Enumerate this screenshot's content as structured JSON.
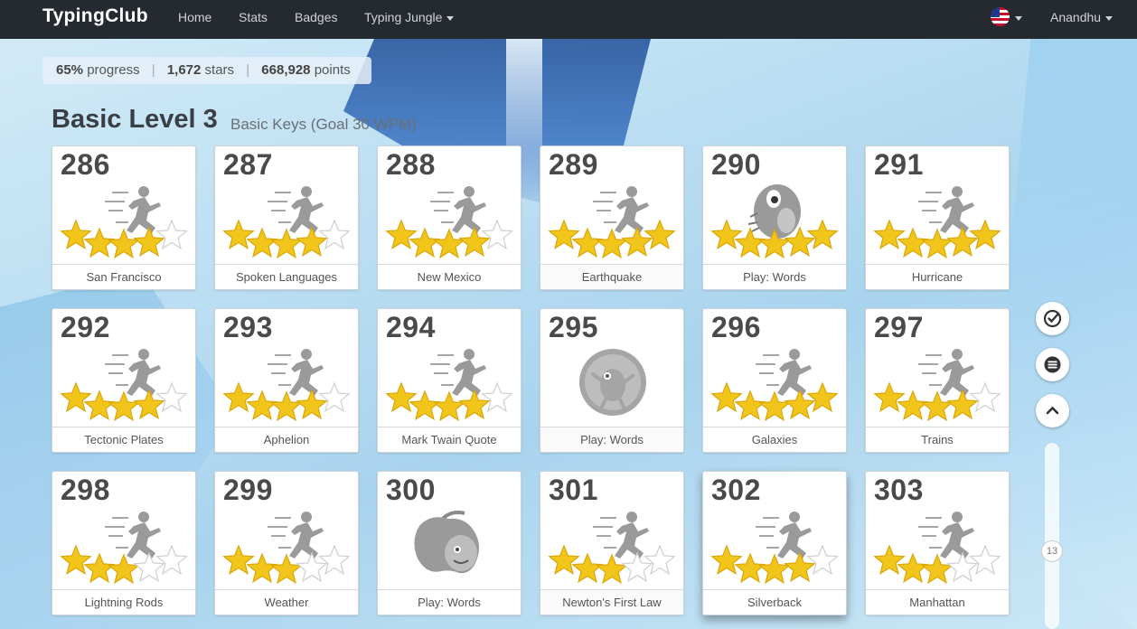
{
  "nav": {
    "brand": "TypingClub",
    "links": [
      "Home",
      "Stats",
      "Badges"
    ],
    "dropdown": "Typing Jungle",
    "user": "Anandhu"
  },
  "progress": {
    "percent": "65%",
    "percent_label": "progress",
    "stars": "1,672",
    "stars_label": "stars",
    "points": "668,928",
    "points_label": "points"
  },
  "level": {
    "title": "Basic Level 3",
    "subtitle": "Basic Keys (Goal 30 WPM)"
  },
  "lessons": [
    {
      "num": "286",
      "name": "San Francisco",
      "type": "typing",
      "stars": 4
    },
    {
      "num": "287",
      "name": "Spoken Languages",
      "type": "typing",
      "stars": 4
    },
    {
      "num": "288",
      "name": "New Mexico",
      "type": "typing",
      "stars": 4
    },
    {
      "num": "289",
      "name": "Earthquake",
      "type": "typing",
      "stars": 5
    },
    {
      "num": "290",
      "name": "Play: Words",
      "type": "game-creature",
      "stars": 5
    },
    {
      "num": "291",
      "name": "Hurricane",
      "type": "typing",
      "stars": 5
    },
    {
      "num": "292",
      "name": "Tectonic Plates",
      "type": "typing",
      "stars": 4
    },
    {
      "num": "293",
      "name": "Aphelion",
      "type": "typing",
      "stars": 4
    },
    {
      "num": "294",
      "name": "Mark Twain Quote",
      "type": "typing",
      "stars": 4
    },
    {
      "num": "295",
      "name": "Play: Words",
      "type": "game-locked",
      "stars": 0
    },
    {
      "num": "296",
      "name": "Galaxies",
      "type": "typing",
      "stars": 5
    },
    {
      "num": "297",
      "name": "Trains",
      "type": "typing",
      "stars": 4
    },
    {
      "num": "298",
      "name": "Lightning Rods",
      "type": "typing",
      "stars": 3
    },
    {
      "num": "299",
      "name": "Weather",
      "type": "typing",
      "stars": 3
    },
    {
      "num": "300",
      "name": "Play: Words",
      "type": "game-apple",
      "stars": 0
    },
    {
      "num": "301",
      "name": "Newton's First Law",
      "type": "typing",
      "stars": 3
    },
    {
      "num": "302",
      "name": "Silverback",
      "type": "typing",
      "stars": 4
    },
    {
      "num": "303",
      "name": "Manhattan",
      "type": "typing",
      "stars": 3
    }
  ],
  "highlighted_lesson": "302",
  "flat_lessons": [
    "289",
    "295",
    "301"
  ],
  "sidebar": {
    "page_number": "13"
  },
  "colors": {
    "navbar": "#252a31",
    "star": "#f2c51a",
    "star_empty": "#ffffff",
    "figure": "#9a9a9a"
  },
  "icons": [
    "flag-us-icon",
    "check-circle-icon",
    "menu-icon",
    "chevron-up-icon",
    "runner-icon",
    "star-icon",
    "creature-icon",
    "apple-icon"
  ]
}
